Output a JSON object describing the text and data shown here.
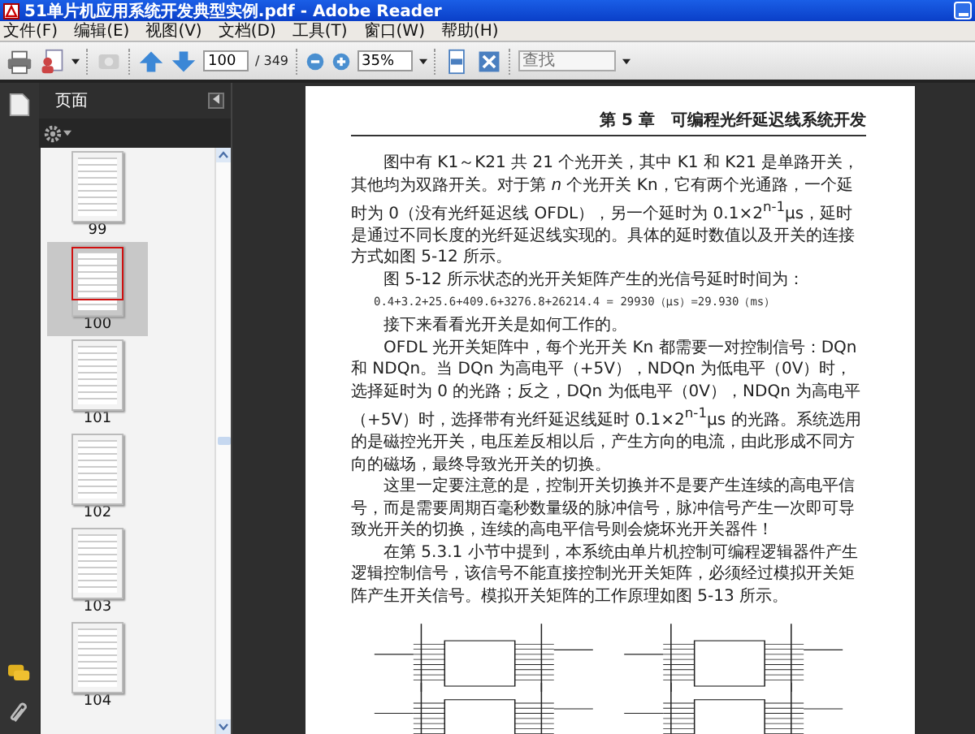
{
  "window": {
    "title": "51单片机应用系统开发典型实例.pdf - Adobe Reader"
  },
  "menu": [
    "文件(F)",
    "编辑(E)",
    "视图(V)",
    "文档(D)",
    "工具(T)",
    "窗口(W)",
    "帮助(H)"
  ],
  "toolbar": {
    "page_number": "100",
    "page_count": "/ 349",
    "zoom": "35%",
    "search": {
      "placeholder": "查找"
    }
  },
  "sidebar": {
    "title": "页面",
    "thumbnails": [
      {
        "label": "99",
        "selected": false
      },
      {
        "label": "100",
        "selected": true
      },
      {
        "label": "101",
        "selected": false
      },
      {
        "label": "102",
        "selected": false
      },
      {
        "label": "103",
        "selected": false
      },
      {
        "label": "104",
        "selected": false
      }
    ]
  },
  "document": {
    "running_head": "第 5 章　可编程光纤延迟线系统开发",
    "paragraphs": [
      {
        "kind": "text",
        "text": "图中有 K1～K21 共 21 个光开关，其中 K1 和 K21 是单路开关，其他均为双路开关。对于第 *n* 个光开关 Kn，它有两个光通路，一个延时为 0（没有光纤延迟线 OFDL），另一个延时为 0.1×2$^{n-1}$μs，延时是通过不同长度的光纤延迟线实现的。具体的延时数值以及开关的连接方式如图 5-12 所示。"
      },
      {
        "kind": "text",
        "text": "图 5-12 所示状态的光开关矩阵产生的光信号延时时间为："
      },
      {
        "kind": "formula",
        "text": "0.4+3.2+25.6+409.6+3276.8+26214.4 = 29930（μs）=29.930（ms）"
      },
      {
        "kind": "text",
        "text": "接下来看看光开关是如何工作的。"
      },
      {
        "kind": "text",
        "text": "OFDL 光开关矩阵中，每个光开关 Kn 都需要一对控制信号：DQn 和 NDQn。当 DQn 为高电平（+5V），NDQn 为低电平（0V）时，选择延时为 0 的光路；反之，DQn 为低电平（0V），NDQn 为高电平（+5V）时，选择带有光纤延迟线延时 0.1×2$^{n-1}$μs 的光路。系统选用的是磁控光开关，电压差反相以后，产生方向的电流，由此形成不同方向的磁场，最终导致光开关的切换。"
      },
      {
        "kind": "text",
        "text": "这里一定要注意的是，控制开关切换并不是要产生连续的高电平信号，而是需要周期百毫秒数量级的脉冲信号，脉冲信号产生一次即可导致光开关的切换，连续的高电平信号则会烧坏光开关器件！"
      },
      {
        "kind": "text",
        "text": "在第 5.3.1 小节中提到，本系统由单片机控制可编程逻辑器件产生逻辑控制信号，该信号不能直接控制光开关矩阵，必须经过模拟开关矩阵产生开关信号。模拟开关矩阵的工作原理如图 5-13 所示。"
      }
    ]
  }
}
